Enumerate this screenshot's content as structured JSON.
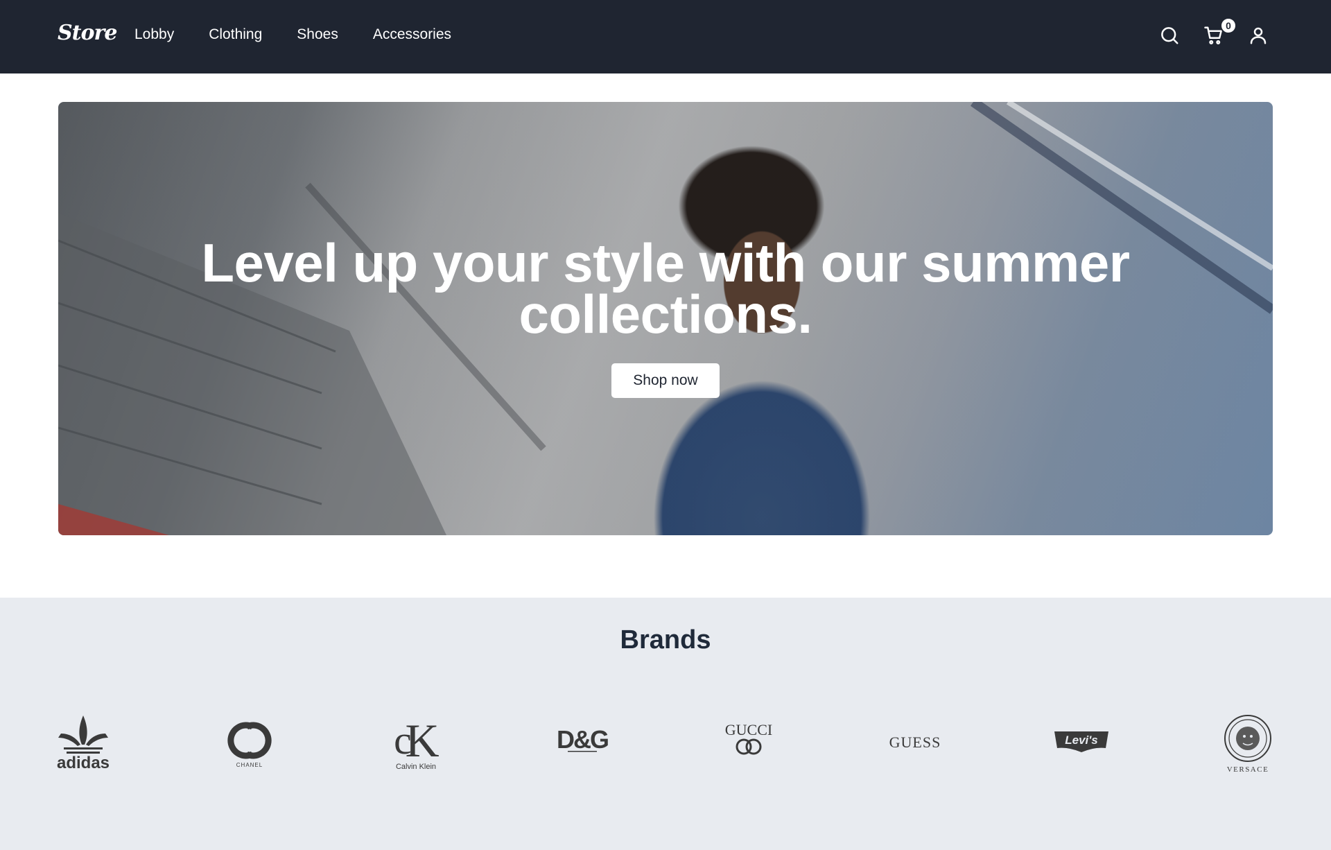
{
  "navbar": {
    "logo": "Store",
    "links": [
      "Lobby",
      "Clothing",
      "Shoes",
      "Accessories"
    ],
    "cart_count": "0",
    "icons": [
      "search-icon",
      "cart-icon",
      "user-icon"
    ]
  },
  "hero": {
    "headline": "Level up your style with our summer collections.",
    "button_label": "Shop now"
  },
  "brands": {
    "title": "Brands",
    "items": [
      {
        "name": "adidas",
        "caption": "adidas"
      },
      {
        "name": "chanel",
        "caption": "CHANEL"
      },
      {
        "name": "calvin-klein",
        "caption": "Calvin Klein"
      },
      {
        "name": "dolce-gabbana",
        "caption": "D&G"
      },
      {
        "name": "gucci",
        "caption": "GUCCI"
      },
      {
        "name": "guess",
        "caption": "GUESS"
      },
      {
        "name": "levis",
        "caption": "Levi's"
      },
      {
        "name": "versace",
        "caption": "VERSACE"
      }
    ]
  },
  "colors": {
    "navbar_bg": "#1f2531",
    "brands_bg": "#e8ebf0",
    "text_dark": "#1f2a3a"
  }
}
